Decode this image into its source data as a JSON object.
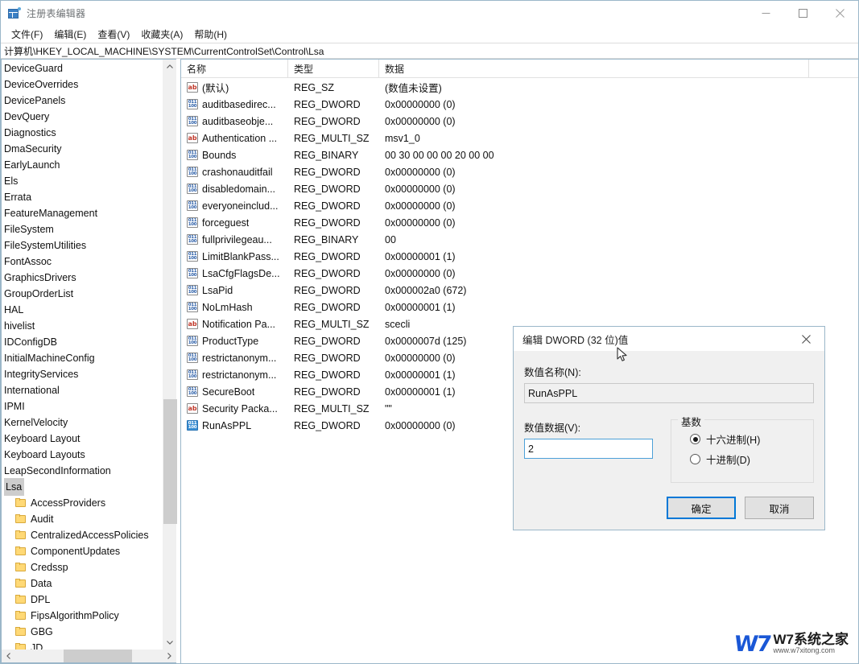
{
  "window": {
    "title": "注册表编辑器",
    "app_icon": "registry-grid-icon",
    "minimize": "minimize-icon",
    "maximize": "maximize-icon",
    "close": "close-icon"
  },
  "menubar": {
    "items": [
      {
        "label": "文件(F)",
        "name": "menu-file"
      },
      {
        "label": "编辑(E)",
        "name": "menu-edit"
      },
      {
        "label": "查看(V)",
        "name": "menu-view"
      },
      {
        "label": "收藏夹(A)",
        "name": "menu-favorites"
      },
      {
        "label": "帮助(H)",
        "name": "menu-help"
      }
    ]
  },
  "address": {
    "path": "计算机\\HKEY_LOCAL_MACHINE\\SYSTEM\\CurrentControlSet\\Control\\Lsa"
  },
  "tree": {
    "items": [
      {
        "label": "DeviceGuard",
        "child": false,
        "selected": false
      },
      {
        "label": "DeviceOverrides",
        "child": false,
        "selected": false
      },
      {
        "label": "DevicePanels",
        "child": false,
        "selected": false
      },
      {
        "label": "DevQuery",
        "child": false,
        "selected": false
      },
      {
        "label": "Diagnostics",
        "child": false,
        "selected": false
      },
      {
        "label": "DmaSecurity",
        "child": false,
        "selected": false
      },
      {
        "label": "EarlyLaunch",
        "child": false,
        "selected": false
      },
      {
        "label": "Els",
        "child": false,
        "selected": false
      },
      {
        "label": "Errata",
        "child": false,
        "selected": false
      },
      {
        "label": "FeatureManagement",
        "child": false,
        "selected": false
      },
      {
        "label": "FileSystem",
        "child": false,
        "selected": false
      },
      {
        "label": "FileSystemUtilities",
        "child": false,
        "selected": false
      },
      {
        "label": "FontAssoc",
        "child": false,
        "selected": false
      },
      {
        "label": "GraphicsDrivers",
        "child": false,
        "selected": false
      },
      {
        "label": "GroupOrderList",
        "child": false,
        "selected": false
      },
      {
        "label": "HAL",
        "child": false,
        "selected": false
      },
      {
        "label": "hivelist",
        "child": false,
        "selected": false
      },
      {
        "label": "IDConfigDB",
        "child": false,
        "selected": false
      },
      {
        "label": "InitialMachineConfig",
        "child": false,
        "selected": false
      },
      {
        "label": "IntegrityServices",
        "child": false,
        "selected": false
      },
      {
        "label": "International",
        "child": false,
        "selected": false
      },
      {
        "label": "IPMI",
        "child": false,
        "selected": false
      },
      {
        "label": "KernelVelocity",
        "child": false,
        "selected": false
      },
      {
        "label": "Keyboard Layout",
        "child": false,
        "selected": false
      },
      {
        "label": "Keyboard Layouts",
        "child": false,
        "selected": false
      },
      {
        "label": "LeapSecondInformation",
        "child": false,
        "selected": false
      },
      {
        "label": "Lsa",
        "child": false,
        "selected": true
      },
      {
        "label": "AccessProviders",
        "child": true,
        "selected": false
      },
      {
        "label": "Audit",
        "child": true,
        "selected": false
      },
      {
        "label": "CentralizedAccessPolicies",
        "child": true,
        "selected": false
      },
      {
        "label": "ComponentUpdates",
        "child": true,
        "selected": false
      },
      {
        "label": "Credssp",
        "child": true,
        "selected": false
      },
      {
        "label": "Data",
        "child": true,
        "selected": false
      },
      {
        "label": "DPL",
        "child": true,
        "selected": false
      },
      {
        "label": "FipsAlgorithmPolicy",
        "child": true,
        "selected": false
      },
      {
        "label": "GBG",
        "child": true,
        "selected": false
      },
      {
        "label": "JD",
        "child": true,
        "selected": false
      }
    ]
  },
  "list": {
    "columns": [
      {
        "label": "名称",
        "name": "column-name"
      },
      {
        "label": "类型",
        "name": "column-type"
      },
      {
        "label": "数据",
        "name": "column-data"
      }
    ],
    "rows": [
      {
        "name": "(默认)",
        "icon": "string-value-icon",
        "type": "REG_SZ",
        "data": "(数值未设置)",
        "selected": false
      },
      {
        "name": "auditbasedirec...",
        "icon": "dword-value-icon",
        "type": "REG_DWORD",
        "data": "0x00000000 (0)",
        "selected": false
      },
      {
        "name": "auditbaseobje...",
        "icon": "dword-value-icon",
        "type": "REG_DWORD",
        "data": "0x00000000 (0)",
        "selected": false
      },
      {
        "name": "Authentication ...",
        "icon": "string-value-icon",
        "type": "REG_MULTI_SZ",
        "data": "msv1_0",
        "selected": false
      },
      {
        "name": "Bounds",
        "icon": "dword-value-icon",
        "type": "REG_BINARY",
        "data": "00 30 00 00 00 20 00 00",
        "selected": false
      },
      {
        "name": "crashonauditfail",
        "icon": "dword-value-icon",
        "type": "REG_DWORD",
        "data": "0x00000000 (0)",
        "selected": false
      },
      {
        "name": "disabledomain...",
        "icon": "dword-value-icon",
        "type": "REG_DWORD",
        "data": "0x00000000 (0)",
        "selected": false
      },
      {
        "name": "everyoneinclud...",
        "icon": "dword-value-icon",
        "type": "REG_DWORD",
        "data": "0x00000000 (0)",
        "selected": false
      },
      {
        "name": "forceguest",
        "icon": "dword-value-icon",
        "type": "REG_DWORD",
        "data": "0x00000000 (0)",
        "selected": false
      },
      {
        "name": "fullprivilegeau...",
        "icon": "dword-value-icon",
        "type": "REG_BINARY",
        "data": "00",
        "selected": false
      },
      {
        "name": "LimitBlankPass...",
        "icon": "dword-value-icon",
        "type": "REG_DWORD",
        "data": "0x00000001 (1)",
        "selected": false
      },
      {
        "name": "LsaCfgFlagsDe...",
        "icon": "dword-value-icon",
        "type": "REG_DWORD",
        "data": "0x00000000 (0)",
        "selected": false
      },
      {
        "name": "LsaPid",
        "icon": "dword-value-icon",
        "type": "REG_DWORD",
        "data": "0x000002a0 (672)",
        "selected": false
      },
      {
        "name": "NoLmHash",
        "icon": "dword-value-icon",
        "type": "REG_DWORD",
        "data": "0x00000001 (1)",
        "selected": false
      },
      {
        "name": "Notification Pa...",
        "icon": "string-value-icon",
        "type": "REG_MULTI_SZ",
        "data": "scecli",
        "selected": false
      },
      {
        "name": "ProductType",
        "icon": "dword-value-icon",
        "type": "REG_DWORD",
        "data": "0x0000007d (125)",
        "selected": false
      },
      {
        "name": "restrictanonym...",
        "icon": "dword-value-icon",
        "type": "REG_DWORD",
        "data": "0x00000000 (0)",
        "selected": false
      },
      {
        "name": "restrictanonym...",
        "icon": "dword-value-icon",
        "type": "REG_DWORD",
        "data": "0x00000001 (1)",
        "selected": false
      },
      {
        "name": "SecureBoot",
        "icon": "dword-value-icon",
        "type": "REG_DWORD",
        "data": "0x00000001 (1)",
        "selected": false
      },
      {
        "name": "Security Packa...",
        "icon": "string-value-icon",
        "type": "REG_MULTI_SZ",
        "data": "\"\"",
        "selected": false
      },
      {
        "name": "RunAsPPL",
        "icon": "dword-value-icon",
        "type": "REG_DWORD",
        "data": "0x00000000 (0)",
        "selected": true
      }
    ]
  },
  "dialog": {
    "title": "编辑 DWORD (32 位)值",
    "close_label": "close-icon",
    "name_label": "数值名称(N):",
    "name_value": "RunAsPPL",
    "data_label": "数值数据(V):",
    "data_value": "2",
    "base_legend": "基数",
    "base_options": [
      {
        "label": "十六进制(H)",
        "checked": true
      },
      {
        "label": "十进制(D)",
        "checked": false
      }
    ],
    "ok_label": "确定",
    "cancel_label": "取消"
  },
  "watermark": {
    "logo": "W7",
    "line1": "W7系统之家",
    "line2": "www.w7xitong.com"
  },
  "colors": {
    "accent": "#0078d7",
    "window_border": "#9bb7c9",
    "selection": "#cdcdcd",
    "folder": "#ffd976",
    "string_icon": "#c0392b",
    "dword_icon": "#2c5fa8"
  }
}
